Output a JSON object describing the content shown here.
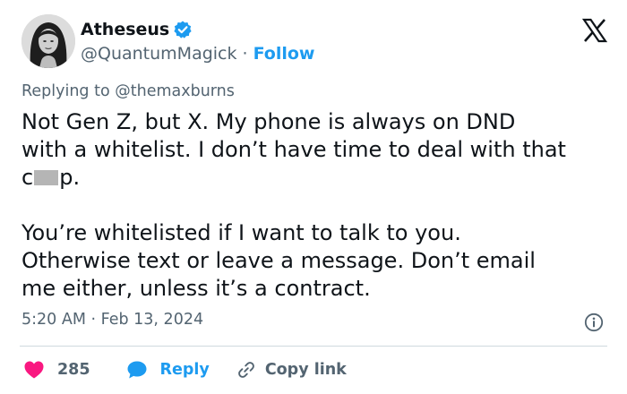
{
  "author": {
    "display_name": "Atheseus",
    "handle": "@QuantumMagick",
    "separator": "·",
    "follow_label": "Follow"
  },
  "reply_context": {
    "prefix": "Replying to",
    "mention": "@themaxburns"
  },
  "tweet": {
    "line1": "Not Gen Z, but X.  My phone is always on DND",
    "line2": "with a whitelist.  I don’t have time to deal with that",
    "line3_start": "c",
    "line3_end": "p.",
    "paragraph2_line1": "You’re whitelisted if I want to talk to you.",
    "paragraph2_line2": "Otherwise text or leave a message. Don’t email",
    "paragraph2_line3": "me either, unless it’s a contract."
  },
  "timestamp": "5:20 AM · Feb 13, 2024",
  "actions": {
    "like_count": "285",
    "reply_label": "Reply",
    "copy_label": "Copy link"
  },
  "colors": {
    "text": "#0f1419",
    "muted": "#536471",
    "link_blue": "#1d9bf0",
    "like_pink": "#f91880",
    "divider": "#cfd9de"
  },
  "icons": [
    "verified-badge-icon",
    "x-logo-icon",
    "info-icon",
    "heart-icon",
    "reply-bubble-icon",
    "link-icon"
  ]
}
